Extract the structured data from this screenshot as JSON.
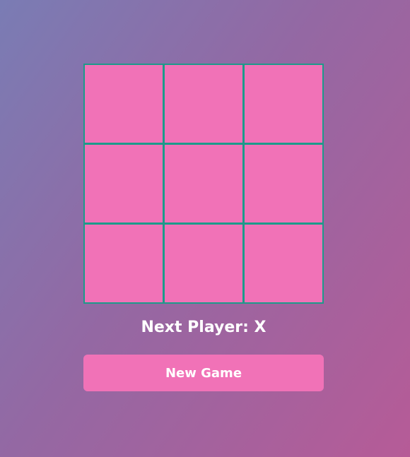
{
  "board": {
    "cells": [
      "",
      "",
      "",
      "",
      "",
      "",
      "",
      "",
      ""
    ]
  },
  "status": {
    "text": "Next Player: X"
  },
  "controls": {
    "new_game_label": "New Game"
  },
  "colors": {
    "cell": "#f172b7",
    "grid_line": "#1d9a8a",
    "button": "#f172b7",
    "text": "#ffffff"
  }
}
